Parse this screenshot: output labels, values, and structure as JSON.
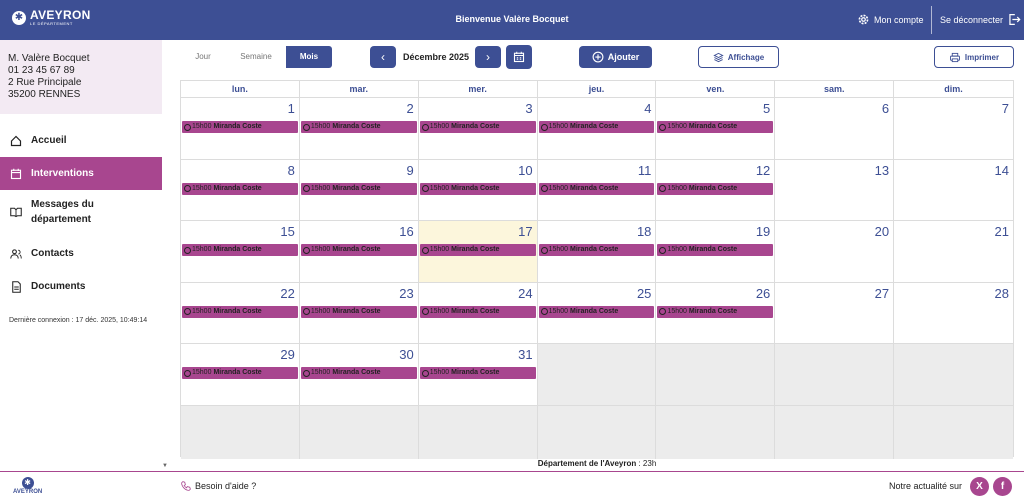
{
  "header": {
    "logo_text": "AVEYRON",
    "logo_sub": "LE DÉPARTEMENT",
    "welcome": "Bienvenue Valère Bocquet",
    "account_label": "Mon compte",
    "logout_label": "Se déconnecter",
    "bg_color": "#3d4f94"
  },
  "sidebar": {
    "user": {
      "name": "M. Valère Bocquet",
      "phone": "01 23 45 67 89",
      "address": "2 Rue Principale",
      "city": "35200 RENNES"
    },
    "items": [
      {
        "label": "Accueil",
        "icon": "home-icon",
        "active": false
      },
      {
        "label": "Interventions",
        "icon": "calendar-icon",
        "active": true
      },
      {
        "label": "Messages du département",
        "icon": "book-icon",
        "active": false
      },
      {
        "label": "Contacts",
        "icon": "people-icon",
        "active": false
      },
      {
        "label": "Documents",
        "icon": "document-icon",
        "active": false
      }
    ],
    "last_login": "Dernière connexion : 17 déc. 2025, 10:49:14",
    "accent_color": "#a8468f"
  },
  "toolbar": {
    "views": [
      "Jour",
      "Semaine",
      "Mois"
    ],
    "active_view": "Mois",
    "month_label": "Décembre 2025",
    "add_label": "Ajouter",
    "display_label": "Affichage",
    "print_label": "Imprimer"
  },
  "calendar": {
    "weekdays": [
      "lun.",
      "mar.",
      "mer.",
      "jeu.",
      "ven.",
      "sam.",
      "dim."
    ],
    "first_weekday_offset": 0,
    "days_in_month": 31,
    "today": 17,
    "event_days": [
      1,
      2,
      3,
      4,
      5,
      8,
      9,
      10,
      11,
      12,
      15,
      16,
      17,
      18,
      19,
      22,
      23,
      24,
      25,
      26,
      29,
      30,
      31
    ],
    "event_time": "15h00",
    "event_name": "Miranda Coste"
  },
  "footer": {
    "department_name": "Département de l'Aveyron",
    "department_suffix": " : 23h",
    "help": "Besoin d'aide ?",
    "news": "Notre actualité sur",
    "logo_text": "AVEYRON"
  }
}
